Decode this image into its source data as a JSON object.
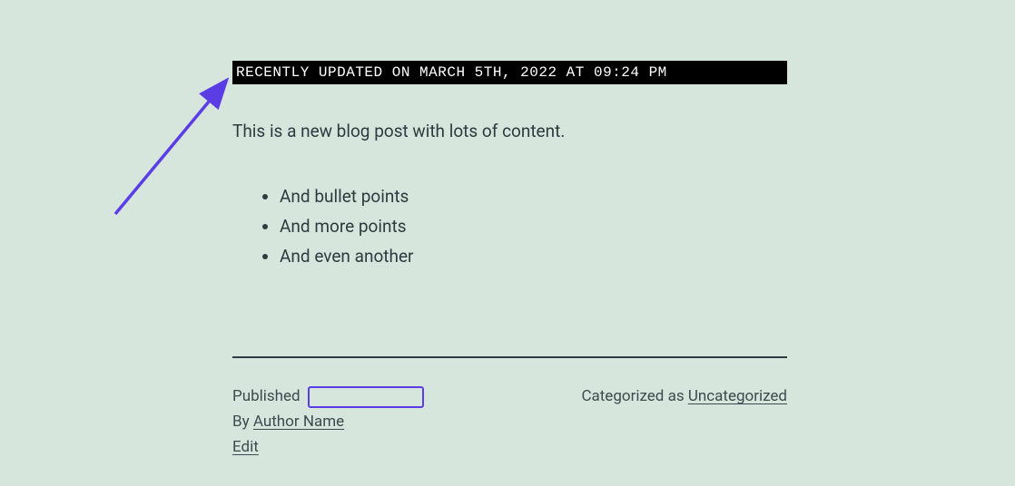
{
  "banner": {
    "text": "RECENTLY UPDATED ON MARCH 5TH, 2022 AT 09:24 PM"
  },
  "content": {
    "intro": "This is a new blog post with lots of content.",
    "bullets": [
      "And bullet points",
      "And more points",
      "And even another"
    ]
  },
  "meta": {
    "published_label": "Published",
    "by_label": "By",
    "author_name": "Author Name",
    "edit_label": "Edit",
    "categorized_label": "Categorized as",
    "category": "Uncategorized"
  },
  "annotations": {
    "arrow_color": "#5b3de6",
    "highlight_color": "#5b3de6"
  }
}
